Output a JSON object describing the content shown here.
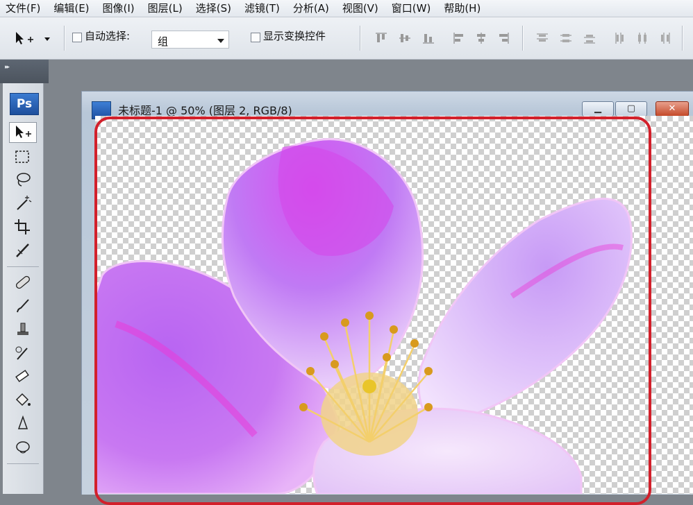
{
  "menu": [
    "文件(F)",
    "编辑(E)",
    "图像(I)",
    "图层(L)",
    "选择(S)",
    "滤镜(T)",
    "分析(A)",
    "视图(V)",
    "窗口(W)",
    "帮助(H)"
  ],
  "options": {
    "auto_select_label": "自动选择:",
    "auto_select_value": "组",
    "show_transform_label": "显示变换控件"
  },
  "toolbox": {
    "logo": "Ps",
    "tools": [
      "move-tool",
      "marquee-tool",
      "lasso-tool",
      "magic-wand-tool",
      "crop-tool",
      "slice-tool",
      "healing-brush-tool",
      "brush-tool",
      "clone-stamp-tool",
      "history-brush-tool",
      "eraser-tool",
      "paint-bucket-tool",
      "blur-tool",
      "dodge-tool"
    ]
  },
  "document": {
    "title": "未标题-1 @ 50% (图层 2, RGB/8)"
  },
  "colors": {
    "highlight": "#d2202b",
    "petal": "#c872f0",
    "petal_accent": "#ea3bd8"
  }
}
